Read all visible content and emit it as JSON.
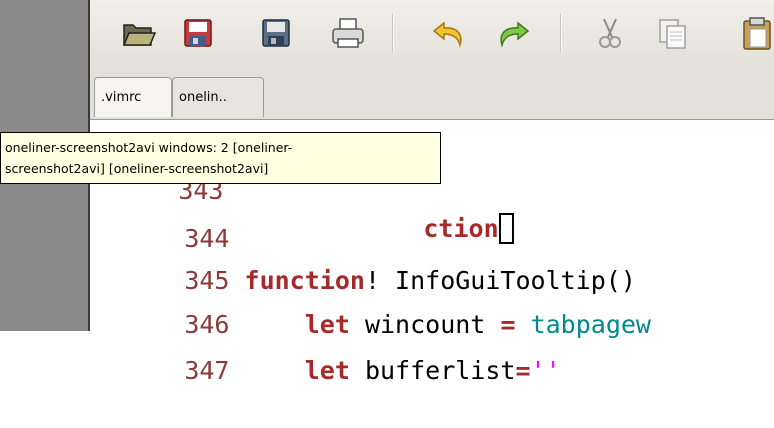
{
  "toolbar": {
    "buttons": [
      {
        "icon": "open-folder-icon"
      },
      {
        "icon": "save-icon"
      },
      {
        "icon": "save-all-icon"
      },
      {
        "icon": "print-icon"
      },
      {
        "icon": "undo-icon"
      },
      {
        "icon": "redo-icon"
      },
      {
        "icon": "cut-icon"
      },
      {
        "icon": "copy-icon"
      },
      {
        "icon": "paste-icon"
      }
    ]
  },
  "tabs": [
    {
      "label": ".vimrc",
      "active": true
    },
    {
      "label": "onelin..",
      "active": false
    }
  ],
  "editor": {
    "lines": [
      {
        "number": "343",
        "keyword": "",
        "text": "ction"
      },
      {
        "number": "344",
        "keyword": "",
        "text": ""
      },
      {
        "number": "345",
        "keyword": "function",
        "text": "! InfoGuiTooltip()"
      },
      {
        "number": "346",
        "keyword": "let",
        "text": "wincount",
        "op": "=",
        "call": "tabpagew"
      },
      {
        "number": "347",
        "keyword": "let",
        "text": "bufferlist",
        "op": "=",
        "str": "''"
      }
    ]
  },
  "tooltip": {
    "line1": "oneliner-screenshot2avi windows: 2 [oneliner-",
    "line2": "screenshot2avi] [oneliner-screenshot2avi]"
  },
  "colors": {
    "tooltip_bg": "#ffffe1",
    "line_number": "#8b3a3a",
    "keyword": "#a52a2a",
    "function_call": "#008b8b"
  }
}
